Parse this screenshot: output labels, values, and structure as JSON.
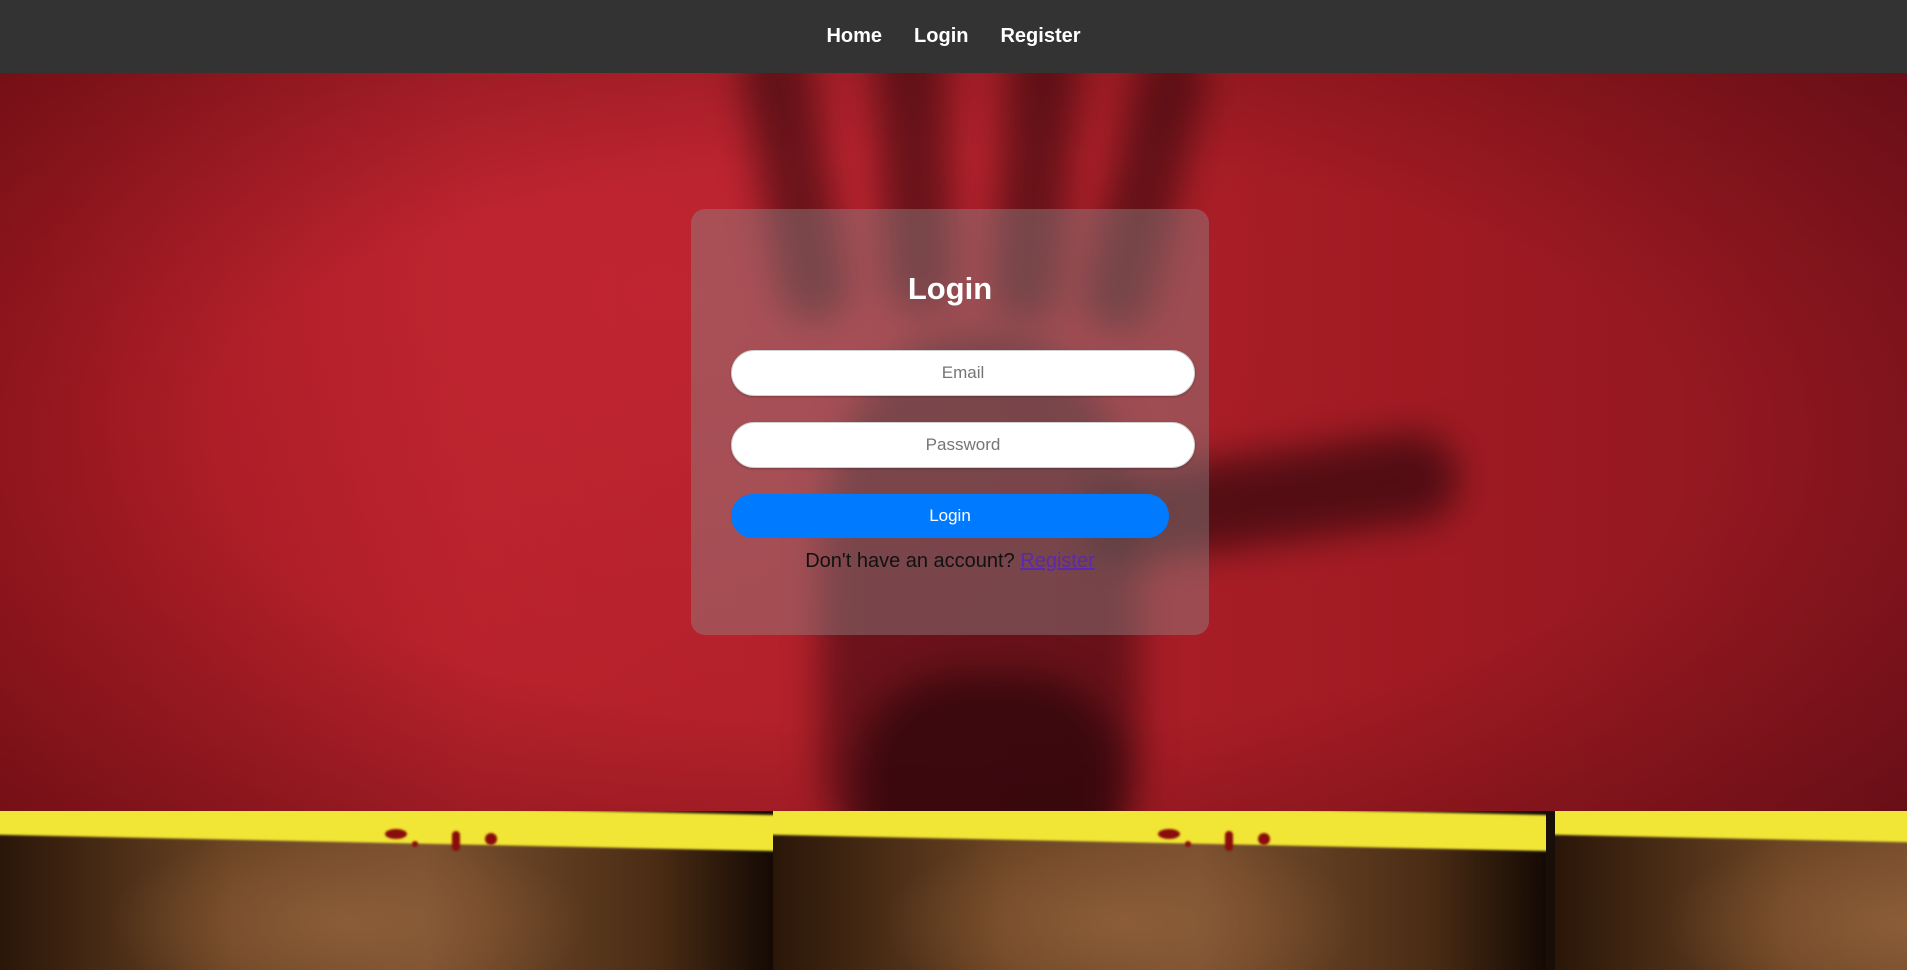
{
  "nav": {
    "items": [
      {
        "label": "Home"
      },
      {
        "label": "Login"
      },
      {
        "label": "Register"
      }
    ]
  },
  "login_form": {
    "title": "Login",
    "email_placeholder": "Email",
    "password_placeholder": "Password",
    "submit_label": "Login",
    "register_prompt": "Don't have an account?",
    "register_link": "Register"
  },
  "colors": {
    "navbar": "#333333",
    "accent_button": "#007bff",
    "background": "#b02029",
    "link": "#5b2aa8"
  }
}
